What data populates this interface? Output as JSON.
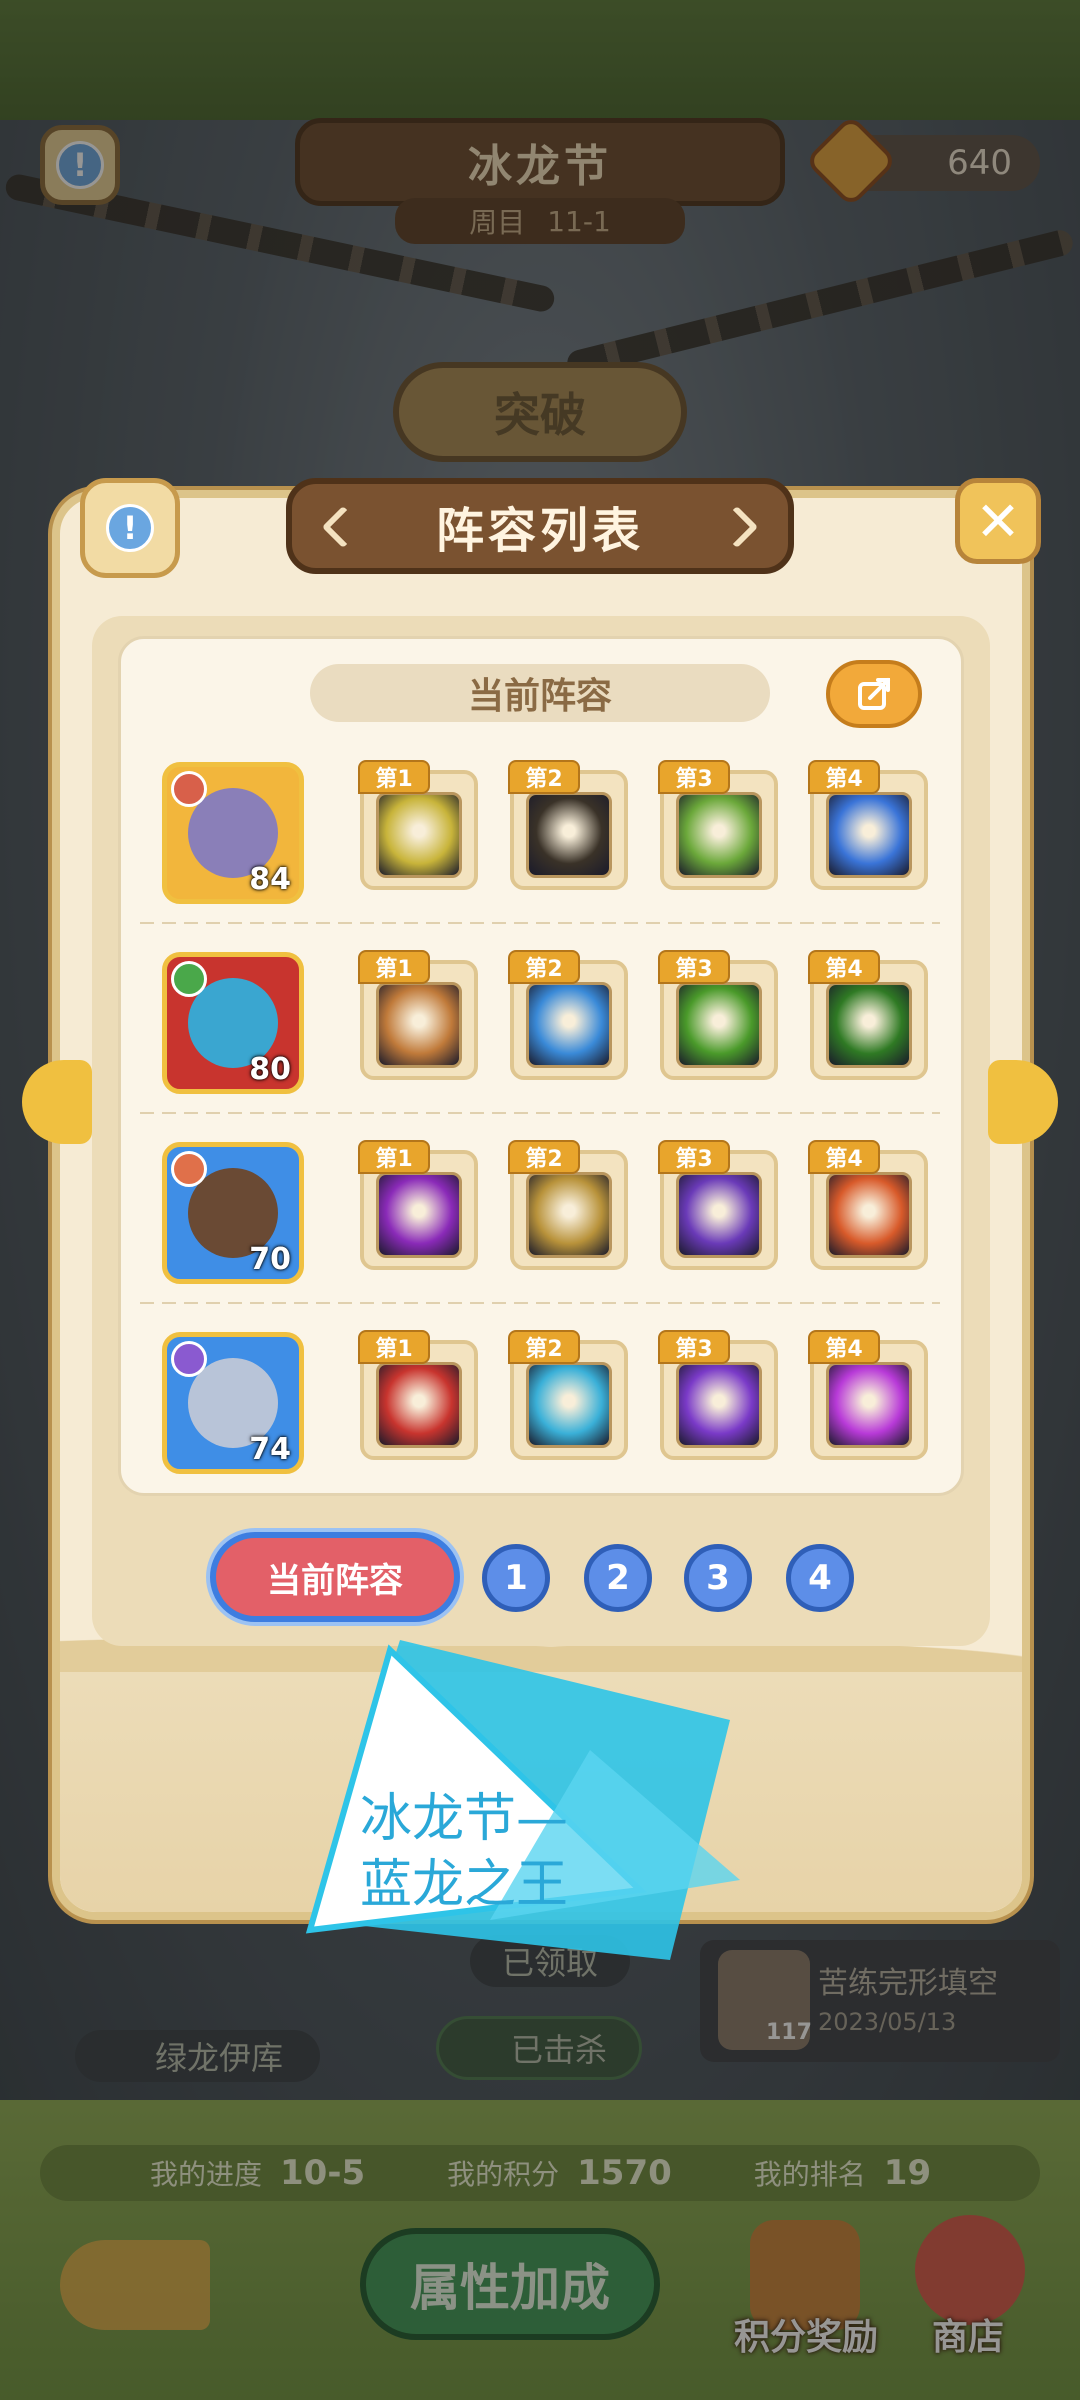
{
  "event": {
    "title": "冰龙节",
    "round_label": "周目",
    "round_value": "11-1",
    "coins": "640",
    "breakthrough_label": "突破"
  },
  "background": {
    "dragon_name": "绿龙伊库",
    "claimed_label": "已领取",
    "killed_label": "已击杀",
    "record": {
      "name": "苦练完形填空",
      "date": "2023/05/13",
      "level": "117"
    },
    "progress": {
      "progress_label": "我的进度",
      "progress_value": "10-5",
      "score_label": "我的积分",
      "score_value": "1570",
      "rank_label": "我的排名",
      "rank_value": "19"
    },
    "attr_button": "属性加成",
    "points_reward": "积分奖励",
    "shop": "商店"
  },
  "dialog": {
    "title": "阵容列表",
    "current_header": "当前阵容",
    "rows": [
      {
        "hero_level": "84",
        "hero_color": "#f2b63c",
        "face_color": "#8a7fb8",
        "elem_color": "#d8604a",
        "skills": [
          {
            "tag": "第1",
            "color": "#c8b43a"
          },
          {
            "tag": "第2",
            "color": "#3a3228"
          },
          {
            "tag": "第3",
            "color": "#6ba83a"
          },
          {
            "tag": "第4",
            "color": "#3a74d8"
          }
        ]
      },
      {
        "hero_level": "80",
        "hero_color": "#c8342e",
        "face_color": "#3aa6d0",
        "elem_color": "#4aa84a",
        "skills": [
          {
            "tag": "第1",
            "color": "#c07a3a"
          },
          {
            "tag": "第2",
            "color": "#3a8ad8"
          },
          {
            "tag": "第3",
            "color": "#4a9a2a"
          },
          {
            "tag": "第4",
            "color": "#2f7a24"
          }
        ]
      },
      {
        "hero_level": "70",
        "hero_color": "#3f8ee6",
        "face_color": "#6a4a34",
        "elem_color": "#e0704a",
        "skills": [
          {
            "tag": "第1",
            "color": "#8a2ab8"
          },
          {
            "tag": "第2",
            "color": "#b8923a"
          },
          {
            "tag": "第3",
            "color": "#6a3ab8"
          },
          {
            "tag": "第4",
            "color": "#d85a2a"
          }
        ]
      },
      {
        "hero_level": "74",
        "hero_color": "#3f8ee6",
        "face_color": "#b8c4d8",
        "elem_color": "#8a5ad0",
        "skills": [
          {
            "tag": "第1",
            "color": "#c8342e"
          },
          {
            "tag": "第2",
            "color": "#3ab0d8"
          },
          {
            "tag": "第3",
            "color": "#7a3ac8"
          },
          {
            "tag": "第4",
            "color": "#b83ad8"
          }
        ]
      }
    ],
    "tabs": {
      "current": "当前阵容",
      "numbers": [
        "1",
        "2",
        "3",
        "4"
      ]
    }
  },
  "overlay": {
    "caption_line1": "冰龙节—",
    "caption_line2": "蓝龙之王"
  },
  "colors": {
    "accent_gold": "#f0c040",
    "tab_red": "#e36068",
    "tab_blue": "#5d8ee8",
    "stamp_cyan": "#2ec4e8"
  }
}
